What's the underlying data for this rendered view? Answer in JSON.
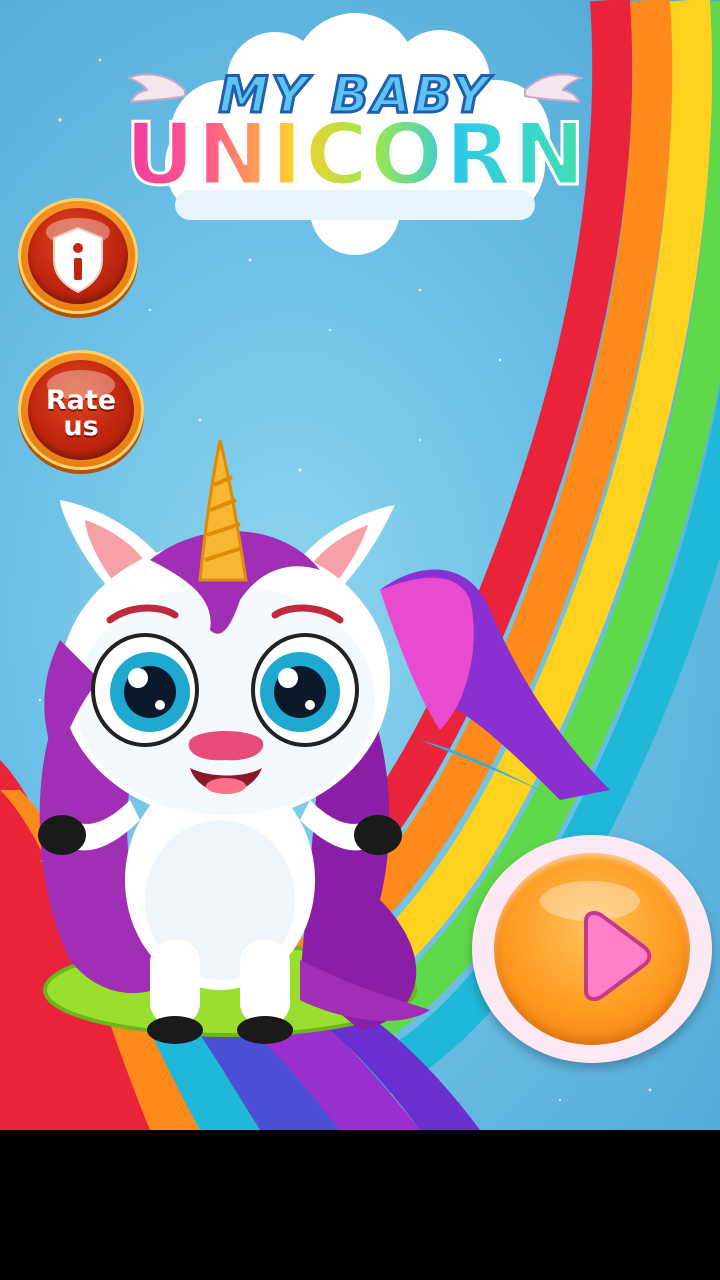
{
  "app": {
    "title_line1": "MY BABY",
    "title_line2": "UNICORN"
  },
  "buttons": {
    "info_icon": "info-shield-icon",
    "rate_label": "Rate\nus",
    "play_icon": "play-icon"
  },
  "colors": {
    "sky": "#6cc0e6",
    "button_orange": "#ff9b21",
    "button_red": "#c0260f",
    "rainbow": [
      "#e8233a",
      "#ff8a1c",
      "#ffd21f",
      "#5fd94a",
      "#1fb8d8",
      "#4a4fd6",
      "#9a2fd0"
    ]
  }
}
